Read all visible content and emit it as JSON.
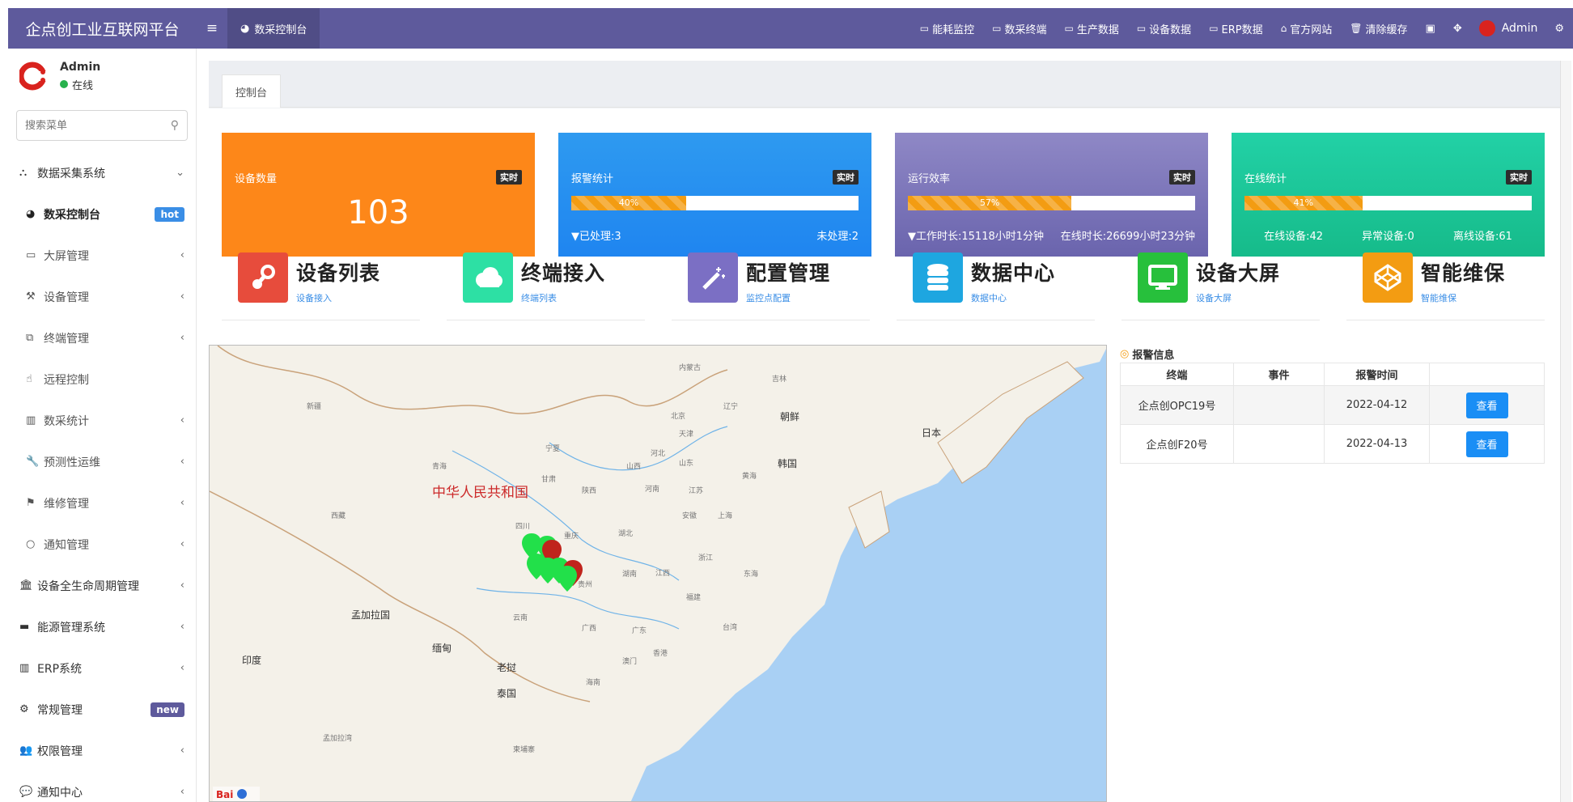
{
  "header": {
    "brand": "企点创工业互联网平台",
    "active_tab": "数采控制台",
    "links": [
      {
        "icon": "monitor-icon",
        "label": "能耗监控"
      },
      {
        "icon": "monitor-icon",
        "label": "数采终端"
      },
      {
        "icon": "monitor-icon",
        "label": "生产数据"
      },
      {
        "icon": "monitor-icon",
        "label": "设备数据"
      },
      {
        "icon": "monitor-icon",
        "label": "ERP数据"
      },
      {
        "icon": "home-icon",
        "label": "官方网站"
      },
      {
        "icon": "trash-icon",
        "label": "清除缓存"
      }
    ],
    "user": "Admin"
  },
  "sidebar": {
    "user": {
      "name": "Admin",
      "status": "在线"
    },
    "search_placeholder": "搜索菜单",
    "items": [
      {
        "label": "数据采集系统",
        "icon": "sitemap-icon",
        "chev": "⌄"
      },
      {
        "label": "数采控制台",
        "icon": "dashboard-icon",
        "badge": "hot"
      },
      {
        "label": "大屏管理",
        "icon": "monitor-icon",
        "chev": "‹"
      },
      {
        "label": "设备管理",
        "icon": "gavel-icon",
        "chev": "‹"
      },
      {
        "label": "终端管理",
        "icon": "clone-icon",
        "chev": "‹"
      },
      {
        "label": "远程控制",
        "icon": "hand-icon",
        "chev": ""
      },
      {
        "label": "数采统计",
        "icon": "bar-chart-icon",
        "chev": "‹"
      },
      {
        "label": "预测性运维",
        "icon": "wrench-icon",
        "chev": "‹"
      },
      {
        "label": "维修管理",
        "icon": "flag-icon",
        "chev": "‹"
      },
      {
        "label": "通知管理",
        "icon": "circle-icon",
        "chev": "‹"
      },
      {
        "label": "设备全生命周期管理",
        "icon": "bank-icon",
        "chev": "‹"
      },
      {
        "label": "能源管理系统",
        "icon": "battery-icon",
        "chev": "‹"
      },
      {
        "label": "ERP系统",
        "icon": "bar-chart-icon",
        "chev": "‹"
      },
      {
        "label": "常规管理",
        "icon": "cogs-icon",
        "badge": "new"
      },
      {
        "label": "权限管理",
        "icon": "users-icon",
        "chev": "‹"
      },
      {
        "label": "通知中心",
        "icon": "comment-icon",
        "chev": "‹"
      }
    ]
  },
  "tabs": [
    "控制台"
  ],
  "stats": [
    {
      "title": "设备数量",
      "badge": "实时",
      "value": "103",
      "color": "#fd7e14"
    },
    {
      "title": "报警统计",
      "badge": "实时",
      "progress": 40,
      "progress_label": "40%",
      "left": "已处理:3",
      "right": "未处理:2"
    },
    {
      "title": "运行效率",
      "badge": "实时",
      "progress": 57,
      "progress_label": "57%",
      "left": "工作时长:15118小时1分钟",
      "right": "在线时长:26699小时23分钟"
    },
    {
      "title": "在线统计",
      "badge": "实时",
      "progress": 41,
      "progress_label": "41%",
      "a": "在线设备:42",
      "b": "异常设备:0",
      "c": "离线设备:61"
    }
  ],
  "tiles": [
    {
      "title": "设备列表",
      "sub": "设备接入",
      "color": "#e74c3c",
      "icon": "steam-icon"
    },
    {
      "title": "终端接入",
      "sub": "终端列表",
      "color": "#2de0a4",
      "icon": "cloud-icon"
    },
    {
      "title": "配置管理",
      "sub": "监控点配置",
      "color": "#7b6fc4",
      "icon": "magic-icon"
    },
    {
      "title": "数据中心",
      "sub": "数据中心",
      "color": "#1ea6e0",
      "icon": "database-icon"
    },
    {
      "title": "设备大屏",
      "sub": "设备大屏",
      "color": "#27c03c",
      "icon": "desktop-icon"
    },
    {
      "title": "智能维保",
      "sub": "智能维保",
      "color": "#f39c12",
      "icon": "codepen-icon"
    }
  ],
  "map": {
    "country": "中华人民共和国",
    "labels": [
      {
        "t": "内蒙古"
      },
      {
        "t": "吉林"
      },
      {
        "t": "新疆"
      },
      {
        "t": "辽宁"
      },
      {
        "t": "北京"
      },
      {
        "t": "天津"
      },
      {
        "t": "朝鲜"
      },
      {
        "t": "日本"
      },
      {
        "t": "宁夏"
      },
      {
        "t": "河北"
      },
      {
        "t": "青海"
      },
      {
        "t": "山西"
      },
      {
        "t": "山东"
      },
      {
        "t": "韩国"
      },
      {
        "t": "甘肃"
      },
      {
        "t": "陕西"
      },
      {
        "t": "河南"
      },
      {
        "t": "江苏"
      },
      {
        "t": "黄海"
      },
      {
        "t": "西藏"
      },
      {
        "t": "四川"
      },
      {
        "t": "重庆"
      },
      {
        "t": "湖北"
      },
      {
        "t": "安徽"
      },
      {
        "t": "上海"
      },
      {
        "t": "浙江"
      },
      {
        "t": "贵州"
      },
      {
        "t": "湖南"
      },
      {
        "t": "江西"
      },
      {
        "t": "东海"
      },
      {
        "t": "福建"
      },
      {
        "t": "孟加拉国"
      },
      {
        "t": "云南"
      },
      {
        "t": "广西"
      },
      {
        "t": "广东"
      },
      {
        "t": "台湾"
      },
      {
        "t": "香港"
      },
      {
        "t": "澳门"
      },
      {
        "t": "海南"
      },
      {
        "t": "印度"
      },
      {
        "t": "缅甸"
      },
      {
        "t": "老挝"
      },
      {
        "t": "泰国"
      },
      {
        "t": "孟加拉湾"
      },
      {
        "t": "柬埔寨"
      }
    ]
  },
  "alarm": {
    "title": "报警信息",
    "headers": [
      "终端",
      "事件",
      "报警时间",
      ""
    ],
    "rows": [
      {
        "terminal": "企点创OPC19号",
        "event": "",
        "time": "2022-04-12",
        "action": "查看"
      },
      {
        "terminal": "企点创F20号",
        "event": "",
        "time": "2022-04-13",
        "action": "查看"
      }
    ]
  }
}
